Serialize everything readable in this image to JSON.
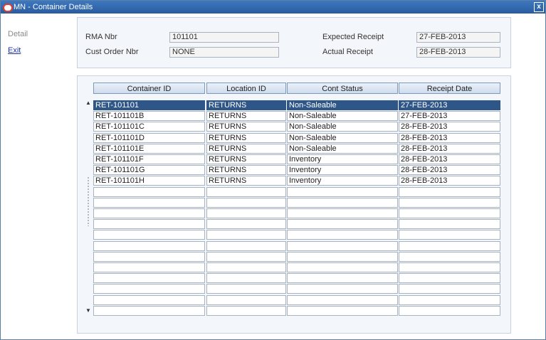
{
  "window": {
    "title": "MN - Container Details",
    "close_label": "x"
  },
  "nav": {
    "detail": "Detail",
    "exit": "Exit"
  },
  "header": {
    "rma_label": "RMA Nbr",
    "rma_value": "101101",
    "cust_order_label": "Cust Order Nbr",
    "cust_order_value": "NONE",
    "expected_label": "Expected Receipt",
    "expected_value": "27-FEB-2013",
    "actual_label": "Actual Receipt",
    "actual_value": "28-FEB-2013"
  },
  "table": {
    "columns": [
      "Container ID",
      "Location ID",
      "Cont Status",
      "Receipt Date"
    ],
    "selected_row": 0,
    "total_rows": 20,
    "rows": [
      [
        "RET-101101",
        "RETURNS",
        "Non-Saleable",
        "27-FEB-2013"
      ],
      [
        "RET-101101B",
        "RETURNS",
        "Non-Saleable",
        "27-FEB-2013"
      ],
      [
        "RET-101101C",
        "RETURNS",
        "Non-Saleable",
        "28-FEB-2013"
      ],
      [
        "RET-101101D",
        "RETURNS",
        "Non-Saleable",
        "28-FEB-2013"
      ],
      [
        "RET-101101E",
        "RETURNS",
        "Non-Saleable",
        "28-FEB-2013"
      ],
      [
        "RET-101101F",
        "RETURNS",
        "Inventory",
        "28-FEB-2013"
      ],
      [
        "RET-101101G",
        "RETURNS",
        "Inventory",
        "28-FEB-2013"
      ],
      [
        "RET-101101H",
        "RETURNS",
        "Inventory",
        "28-FEB-2013"
      ]
    ]
  },
  "colors": {
    "title_bar": "#2a5c9e",
    "selected_row": "#2f5688",
    "link": "#1a33a8"
  },
  "icons": {
    "app": "oracle-logo-icon",
    "close": "close-icon",
    "scroll_up": "scroll-up-arrow-icon",
    "scroll_down": "scroll-down-arrow-icon"
  }
}
